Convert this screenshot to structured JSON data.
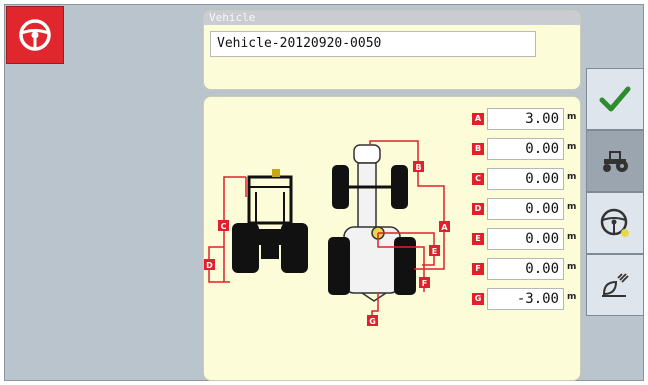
{
  "vehicle": {
    "header": "Vehicle",
    "name": "Vehicle-20120920-0050"
  },
  "dimensions": [
    {
      "tag": "A",
      "value": "3.00",
      "unit": "m"
    },
    {
      "tag": "B",
      "value": "0.00",
      "unit": "m"
    },
    {
      "tag": "C",
      "value": "0.00",
      "unit": "m"
    },
    {
      "tag": "D",
      "value": "0.00",
      "unit": "m"
    },
    {
      "tag": "E",
      "value": "0.00",
      "unit": "m"
    },
    {
      "tag": "F",
      "value": "0.00",
      "unit": "m"
    },
    {
      "tag": "G",
      "value": "-3.00",
      "unit": "m"
    }
  ],
  "diagram_labels": [
    "C",
    "D",
    "A",
    "B",
    "E",
    "F",
    "G"
  ],
  "sidebar": {
    "items": [
      {
        "icon": "checkmark-icon",
        "active": false
      },
      {
        "icon": "tractor-icon",
        "active": true
      },
      {
        "icon": "steering-wheel-icon",
        "active": false
      },
      {
        "icon": "antenna-receiver-icon",
        "active": false
      }
    ]
  },
  "colors": {
    "accent_red": "#e0272d",
    "panel_bg": "#fcfcd8",
    "frame_bg": "#b9c4cd",
    "confirm_green": "#2e8b2e"
  }
}
